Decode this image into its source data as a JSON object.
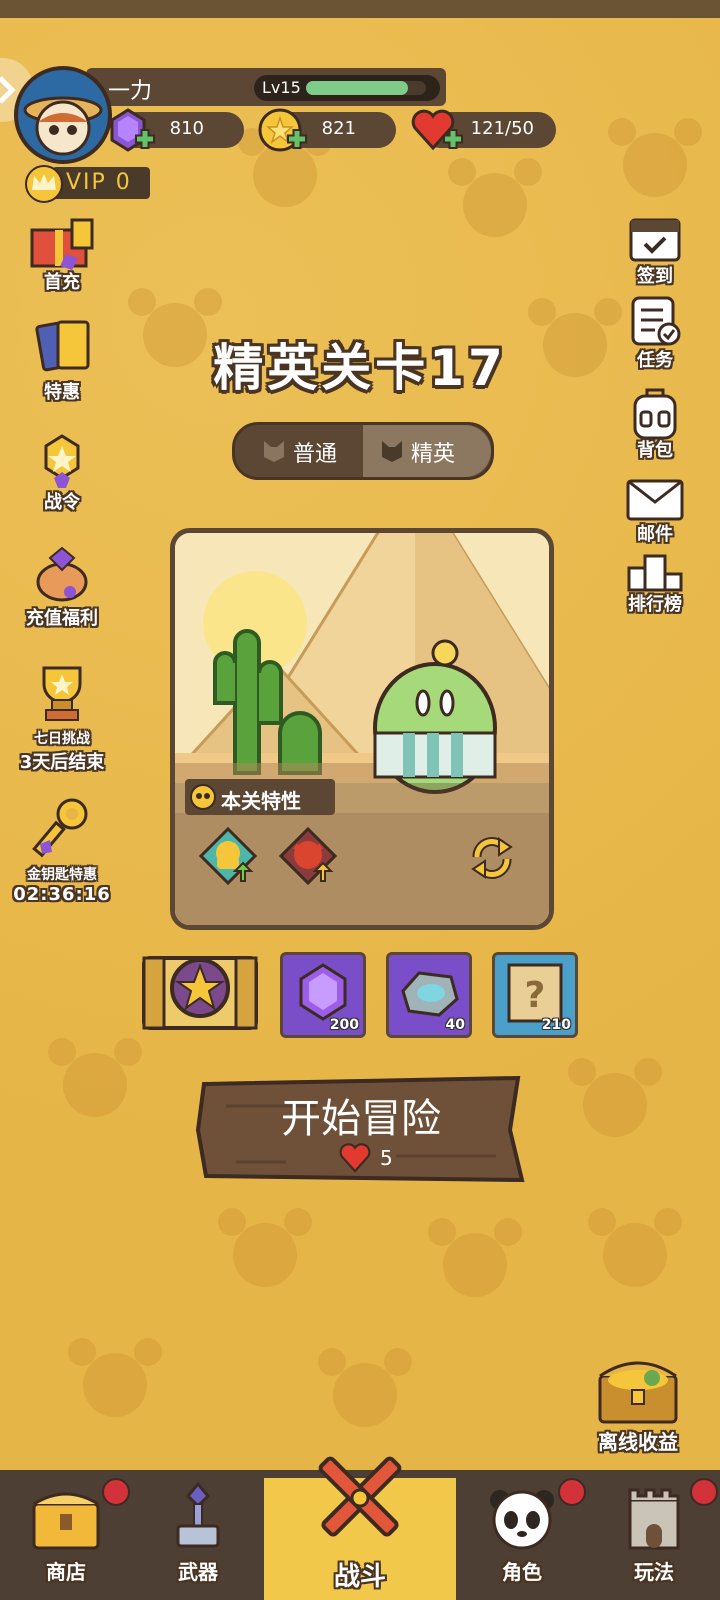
{
  "player": {
    "name": "一力",
    "level": "Lv15",
    "exp_fraction": 0.85,
    "vip": "VIP 0"
  },
  "currencies": {
    "gems": "810",
    "gold": "821",
    "stamina": "121/50"
  },
  "left_menu": [
    {
      "label": "首充",
      "icon": "gift-box-icon"
    },
    {
      "label": "特惠",
      "icon": "cards-icon"
    },
    {
      "label": "战令",
      "icon": "battle-pass-icon"
    },
    {
      "label": "充值福利",
      "icon": "piggy-bank-icon"
    },
    {
      "label": "七日挑战",
      "sublabel": "3天后结束",
      "icon": "trophy-icon"
    },
    {
      "label": "金钥匙特惠",
      "sublabel": "02:36:16",
      "icon": "golden-key-icon"
    }
  ],
  "right_menu": [
    {
      "label": "签到",
      "icon": "calendar-icon"
    },
    {
      "label": "任务",
      "icon": "task-list-icon"
    },
    {
      "label": "背包",
      "icon": "backpack-icon"
    },
    {
      "label": "邮件",
      "icon": "mail-icon"
    },
    {
      "label": "排行榜",
      "icon": "podium-icon"
    }
  ],
  "stage": {
    "title": "精英关卡17",
    "tabs": [
      "普通",
      "精英"
    ],
    "active_tab": "精英",
    "traits_label": "本关特性"
  },
  "rewards": [
    {
      "icon": "star-chest-icon",
      "count": ""
    },
    {
      "icon": "purple-gem-icon",
      "count": "200"
    },
    {
      "icon": "stone-icon",
      "count": "40"
    },
    {
      "icon": "mystery-scroll-icon",
      "count": "210"
    }
  ],
  "start_button": {
    "label": "开始冒险",
    "cost": "5"
  },
  "offline": {
    "label": "离线收益"
  },
  "nav": [
    {
      "label": "商店",
      "icon": "chest-icon",
      "badge": true
    },
    {
      "label": "武器",
      "icon": "weapon-icon",
      "badge": false
    },
    {
      "label": "战斗",
      "icon": "crossed-swords-icon",
      "badge": false,
      "active": true
    },
    {
      "label": "角色",
      "icon": "panda-icon",
      "badge": true
    },
    {
      "label": "玩法",
      "icon": "castle-icon",
      "badge": true
    }
  ],
  "colors": {
    "background": "#e6b547",
    "panel": "#5b4733",
    "nav_active": "#f2c84b",
    "badge": "#d4323a",
    "exp_bar": "#7ecb8a"
  }
}
